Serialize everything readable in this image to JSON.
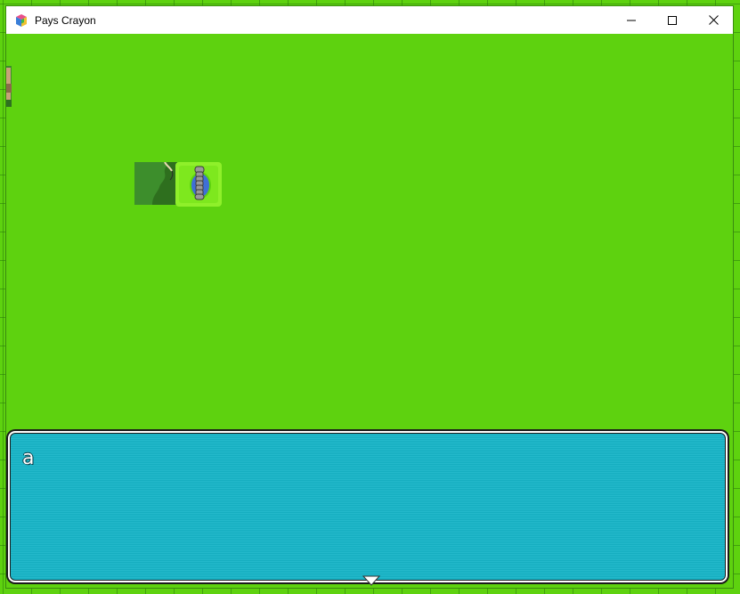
{
  "window": {
    "title": "Pays Crayon",
    "icon": "app-icon"
  },
  "controls": {
    "minimize_icon": "minimize-icon",
    "maximize_icon": "maximize-icon",
    "close_icon": "close-icon"
  },
  "game": {
    "ground_color": "#5ed20f",
    "grid_color": "#3a8a10",
    "sprites": {
      "tree": "tree-sprite",
      "player": "player-sprite",
      "edge_prop": "edge-prop-sprite"
    }
  },
  "dialog": {
    "text": "a",
    "box_color": "#16b5c8",
    "continue_icon": "continue-arrow-icon"
  }
}
